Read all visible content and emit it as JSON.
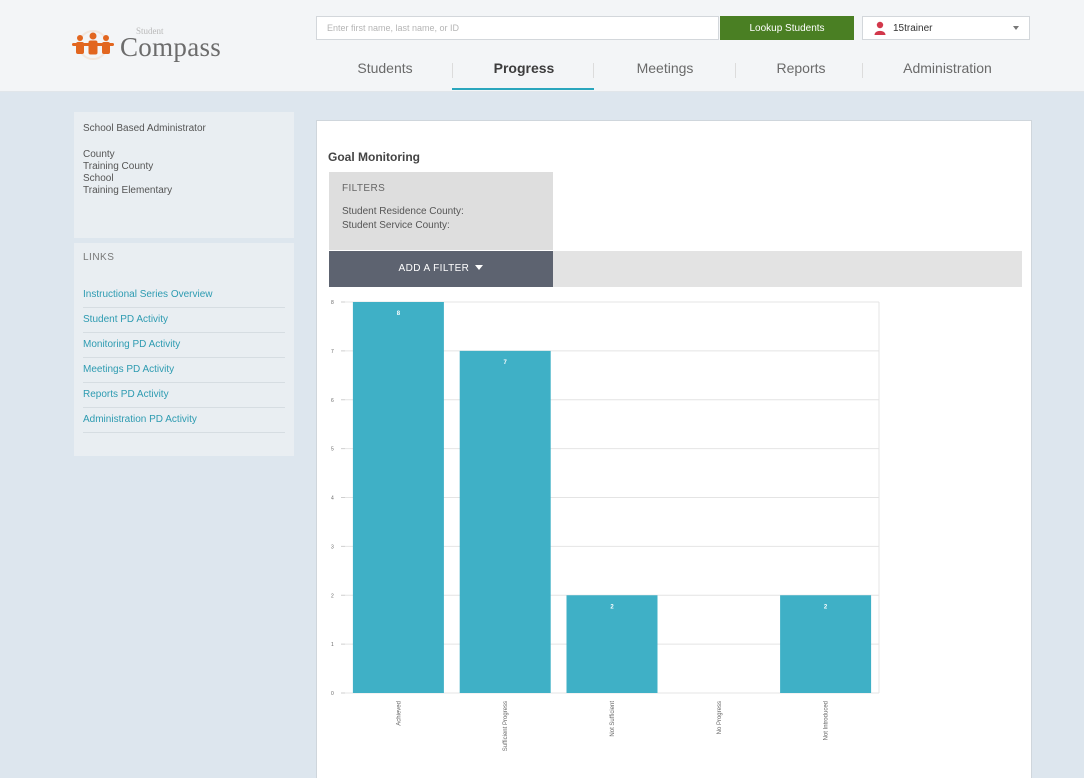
{
  "header": {
    "logo_small": "Student",
    "logo_name": "Compass",
    "search": {
      "placeholder": "Enter first name, last name, or ID",
      "value": ""
    },
    "lookup_label": "Lookup Students",
    "user": {
      "name": "15trainer",
      "icon": "user-icon"
    },
    "accent": "#4a7f23"
  },
  "nav": {
    "tabs": [
      {
        "label": "Students",
        "active": false
      },
      {
        "label": "Progress",
        "active": true
      },
      {
        "label": "Meetings",
        "active": false
      },
      {
        "label": "Reports",
        "active": false
      },
      {
        "label": "Administration",
        "active": false
      }
    ]
  },
  "sidebar": {
    "role": "School Based Administrator",
    "county_label": "County",
    "county_value": "Training County",
    "school_label": "School",
    "school_value": "Training Elementary",
    "links_title": "LINKS",
    "links": [
      "Instructional Series Overview",
      "Student PD Activity",
      "Monitoring PD Activity",
      "Meetings PD Activity",
      "Reports PD Activity",
      "Administration PD Activity"
    ]
  },
  "main": {
    "title": "Goal Monitoring",
    "filters": {
      "label": "FILTERS",
      "residence": "Student Residence County:",
      "service": "Student Service County:"
    },
    "add_filter_label": "ADD A FILTER"
  },
  "chart_data": {
    "type": "bar",
    "categories": [
      "Achieved",
      "Sufficient Progress",
      "Not Sufficient",
      "No Progress",
      "Not Introduced"
    ],
    "values": [
      8,
      7,
      2,
      0,
      2
    ],
    "data_labels": [
      "8",
      "7",
      "2",
      "",
      "2"
    ],
    "y_ticks": [
      "0",
      "1",
      "2",
      "3",
      "4",
      "5",
      "6",
      "7",
      "8"
    ],
    "ylim": [
      0,
      8
    ],
    "grid": true,
    "bar_color": "#3fb0c6"
  }
}
